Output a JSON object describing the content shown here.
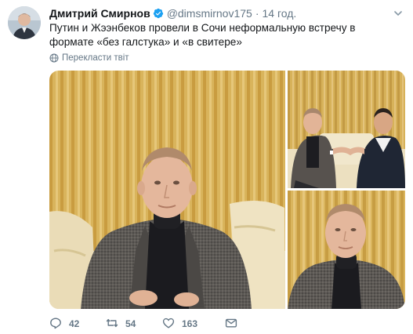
{
  "tweet": {
    "author": {
      "display_name": "Дмитрий Смирнов",
      "handle": "@dimsmirnov175",
      "verified": true
    },
    "separator": "·",
    "time": "14 год.",
    "text": "Путин и Жээнбеков провели в Сочи неформальную встречу в формате «без галстука» и «в свитере»",
    "translate_label": "Перекласти твіт",
    "media": {
      "photo_count": 3,
      "accent_colors": {
        "curtain": "#d8b45a",
        "sofa": "#ece0bf",
        "jacket": "#5b5753",
        "turtleneck": "#1a1a1e"
      }
    },
    "actions": {
      "reply_count": "42",
      "retweet_count": "54",
      "like_count": "163"
    },
    "icons": {
      "verified": "verified-badge-icon",
      "caret": "chevron-down-icon",
      "translate": "globe-icon",
      "reply": "reply-icon",
      "retweet": "retweet-icon",
      "like": "heart-icon",
      "dm": "envelope-icon"
    },
    "colors": {
      "name": "#14171a",
      "secondary": "#657786",
      "verified": "#1da1f2"
    }
  }
}
